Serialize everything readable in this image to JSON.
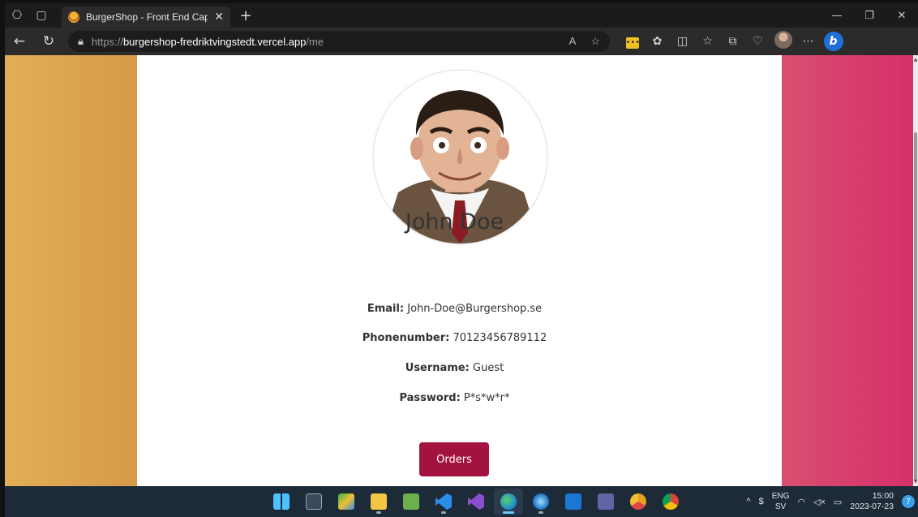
{
  "browser": {
    "tab_title": "BurgerShop - Front End Capston",
    "url_prefix": "https://",
    "url_host": "burgershop-fredriktvingstedt.vercel.app",
    "url_path": "/me"
  },
  "profile": {
    "name": "John Doe",
    "email_label": "Email:",
    "email": "John-Doe@Burgershop.se",
    "phone_label": "Phonenumber:",
    "phone": "70123456789112",
    "username_label": "Username:",
    "username": "Guest",
    "password_label": "Password:",
    "password": "P*s*w*r*",
    "orders_button": "Orders"
  },
  "colors": {
    "left_gradient": "#e0ae55",
    "right_gradient": "#d6306a",
    "orders_button": "#a3133f"
  },
  "taskbar": {
    "lang_top": "ENG",
    "lang_bottom": "SV",
    "time": "15:00",
    "date": "2023-07-23",
    "notification_count": "7"
  }
}
